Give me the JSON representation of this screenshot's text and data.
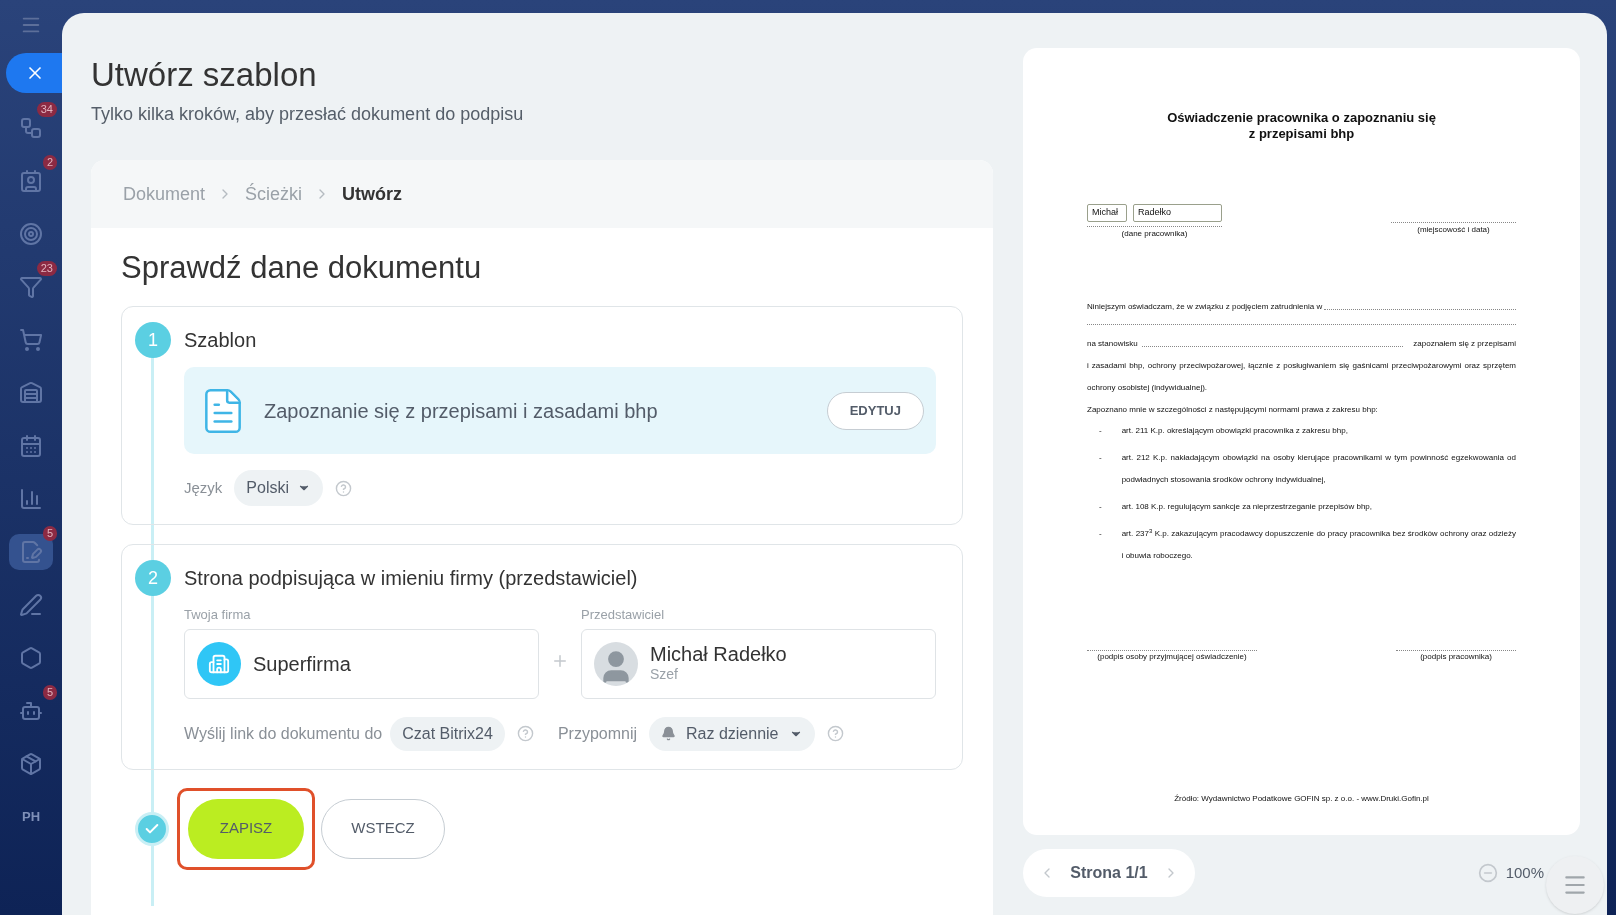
{
  "sidebar": {
    "items": [
      {
        "kind": "flow",
        "badge": "34",
        "selected": false
      },
      {
        "kind": "contact",
        "badge": "2",
        "selected": false
      },
      {
        "kind": "target",
        "selected": false
      },
      {
        "kind": "funnel",
        "badge": "23",
        "selected": false
      },
      {
        "kind": "cart",
        "selected": false
      },
      {
        "kind": "warehouse",
        "selected": false
      },
      {
        "kind": "calendar",
        "selected": false
      },
      {
        "kind": "chart",
        "selected": false
      },
      {
        "kind": "sign",
        "badge": "5",
        "selected": true
      },
      {
        "kind": "pen",
        "selected": false
      },
      {
        "kind": "hexagon",
        "selected": false
      },
      {
        "kind": "robot",
        "badge": "5",
        "selected": false
      },
      {
        "kind": "box",
        "selected": false
      },
      {
        "kind": "text",
        "label": "PH",
        "selected": false
      }
    ]
  },
  "header": {
    "title": "Utwórz szablon",
    "subtitle": "Tylko kilka kroków, aby przesłać dokument do podpisu"
  },
  "breadcrumbs": [
    {
      "label": "Dokument",
      "selected": false
    },
    {
      "label": "Ścieżki",
      "selected": false
    },
    {
      "label": "Utwórz",
      "selected": true
    }
  ],
  "form": {
    "heading": "Sprawdź dane dokumentu",
    "step_template": {
      "number": "1",
      "title": "Szablon",
      "template_name": "Zapoznanie się z przepisami i zasadami bhp",
      "edit_button": "EDYTUJ",
      "language_label": "Język",
      "language_value": "Polski"
    },
    "step_signer": {
      "number": "2",
      "title": "Strona podpisująca w imieniu firmy (przedstawiciel)",
      "company_label": "Twoja firma",
      "company": "Superfirma",
      "representative_label": "Przedstawiciel",
      "representative_name": "Michał Radełko",
      "representative_role": "Szef",
      "send_link_label": "Wyślij link do dokumentu do",
      "send_link_value": "Czat Bitrix24",
      "remind_label": "Przypomnij",
      "remind_value": "Raz dziennie"
    },
    "actions": {
      "save": "ZAPISZ",
      "save_highlighted": true,
      "back": "WSTECZ"
    }
  },
  "preview": {
    "document": {
      "title": [
        "Oświadczenie pracownika o zapoznaniu się",
        "z przepisami bhp"
      ],
      "first_name": "Michał",
      "last_name": "Radełko",
      "caption_employee": "(dane pracownika)",
      "caption_place": "(miejscowość i data)",
      "line_employment": "Niniejszym oświadczam, że w związku z podjęciem zatrudnienia w",
      "line_position": "na stanowisku",
      "line_position_end": "zapoznałem się z przepisami",
      "paragraph": "i zasadami bhp, ochrony przeciwpożarowej, łącznie z posługiwaniem się gaśnicami przeciwpożarowymi oraz sprzętem ochrony osobistej (indywidualnej).",
      "list_intro": "Zapoznano mnie w szczególności z następującymi normami prawa z zakresu bhp:",
      "list": [
        {
          "marker": "-",
          "text": "art. 211 K.p. określającym obowiązki pracownika z zakresu bhp,"
        },
        {
          "marker": "-",
          "text": "art. 212 K.p. nakładającym obowiązki na osoby kierujące pracownikami w tym powinność egzekwowania od podwładnych stosowania środków ochrony indywidualnej,"
        },
        {
          "marker": "-",
          "text": "art. 108 K.p. regulującym sankcje za nieprzestrzeganie przepisów bhp,"
        },
        {
          "marker": "-",
          "text": "art. 237$^{3}$ K.p. zakazującym pracodawcy dopuszczenie do pracy pracownika bez środków ochrony oraz odzieży i obuwia roboczego."
        }
      ],
      "signature_receiver": "(podpis osoby przyjmującej oświadczenie)",
      "signature_employee": "(podpis pracownika)",
      "source": "Źródło: Wydawnictwo Podatkowe GOFIN sp. z o.o. - www.Druki.Gofin.pl"
    },
    "pager": "Strona 1/1",
    "zoom": "100%"
  }
}
